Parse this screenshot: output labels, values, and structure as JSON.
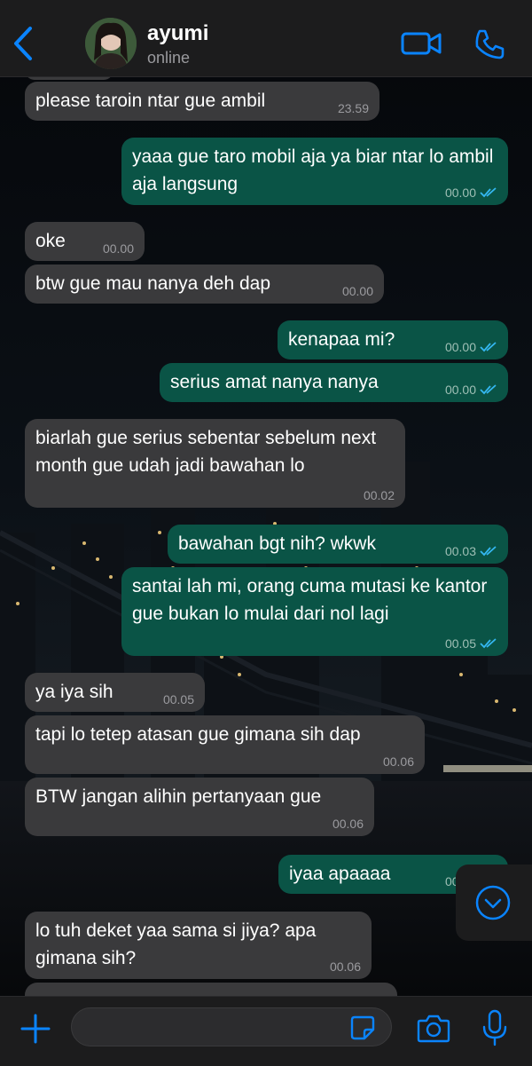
{
  "header": {
    "contact_name": "ayumi",
    "status": "online"
  },
  "colors": {
    "accent": "#0a84ff",
    "outgoing_bubble": "#0a5446",
    "incoming_bubble": "#3a3a3c",
    "read_ticks": "#34b7f1"
  },
  "messages": [
    {
      "direction": "in",
      "text": "please taroin ntar gue ambil",
      "time": "23.59"
    },
    {
      "direction": "out",
      "text": "yaaa gue taro mobil aja ya biar ntar lo ambil aja langsung",
      "time": "00.00",
      "status": "read"
    },
    {
      "direction": "in",
      "text": "oke",
      "time": "00.00"
    },
    {
      "direction": "in",
      "text": "btw gue mau nanya deh dap",
      "time": "00.00"
    },
    {
      "direction": "out",
      "text": "kenapaa mi?",
      "time": "00.00",
      "status": "read"
    },
    {
      "direction": "out",
      "text": "serius amat nanya nanya",
      "time": "00.00",
      "status": "read"
    },
    {
      "direction": "in",
      "text": "biarlah gue serius sebentar sebelum next month gue udah jadi bawahan lo",
      "time": "00.02"
    },
    {
      "direction": "out",
      "text": "bawahan bgt nih? wkwk",
      "time": "00.03",
      "status": "read"
    },
    {
      "direction": "out",
      "text": "santai lah mi, orang cuma mutasi ke kantor gue bukan lo mulai dari nol lagi",
      "time": "00.05",
      "status": "read"
    },
    {
      "direction": "in",
      "text": "ya iya sih",
      "time": "00.05"
    },
    {
      "direction": "in",
      "text": "tapi lo tetep atasan gue gimana sih dap",
      "time": "00.06"
    },
    {
      "direction": "in",
      "text": "BTW jangan alihin pertanyaan gue",
      "time": "00.06"
    },
    {
      "direction": "out",
      "text": "iyaa apaaaa",
      "time": "00.06",
      "status": "read"
    },
    {
      "direction": "in",
      "text": "lo tuh deket yaa sama si jiya? apa gimana sih?",
      "time": "00.06"
    }
  ],
  "composer": {
    "value": "",
    "placeholder": ""
  },
  "icons": {
    "back": "chevron-left-icon",
    "video": "video-camera-icon",
    "call": "phone-icon",
    "scroll": "chevron-down-circle-icon",
    "attach": "plus-icon",
    "sticker": "sticker-icon",
    "camera": "camera-icon",
    "mic": "microphone-icon"
  }
}
